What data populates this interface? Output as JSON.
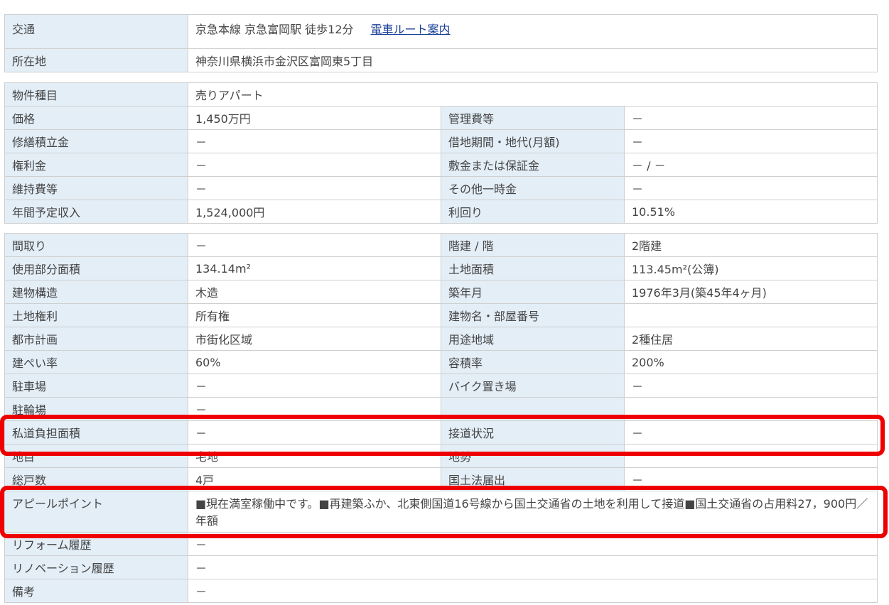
{
  "colors": {
    "header_bg": "#e3eef7",
    "border": "#cfcfcf",
    "link": "#1a3f99",
    "highlight": "#ee0000"
  },
  "access": {
    "transport_label": "交通",
    "transport_value": "京急本線 京急富岡駅 徒歩12分",
    "route_link": "電車ルート案内",
    "address_label": "所在地",
    "address_value": "神奈川県横浜市金沢区富岡東5丁目"
  },
  "price_table": {
    "type_label": "物件種目",
    "type_value": "売りアパート",
    "rows": [
      {
        "l1": "価格",
        "v1": "1,450万円",
        "l2": "管理費等",
        "v2": "－"
      },
      {
        "l1": "修繕積立金",
        "v1": "－",
        "l2": "借地期間・地代(月額)",
        "v2": "－"
      },
      {
        "l1": "権利金",
        "v1": "－",
        "l2": "敷金または保証金",
        "v2": "－ / －"
      },
      {
        "l1": "維持費等",
        "v1": "－",
        "l2": "その他一時金",
        "v2": "－"
      },
      {
        "l1": "年間予定収入",
        "v1": "1,524,000円",
        "l2": "利回り",
        "v2": "10.51%"
      }
    ]
  },
  "detail_table": {
    "rows": [
      {
        "l1": "間取り",
        "v1": "－",
        "l2": "階建 / 階",
        "v2": "2階建"
      },
      {
        "l1": "使用部分面積",
        "v1": "134.14m²",
        "l2": "土地面積",
        "v2": "113.45m²(公簿)"
      },
      {
        "l1": "建物構造",
        "v1": "木造",
        "l2": "築年月",
        "v2": "1976年3月(築45年4ヶ月)"
      },
      {
        "l1": "土地権利",
        "v1": "所有権",
        "l2": "建物名・部屋番号",
        "v2": ""
      },
      {
        "l1": "都市計画",
        "v1": "市街化区域",
        "l2": "用途地域",
        "v2": "2種住居"
      },
      {
        "l1": "建ぺい率",
        "v1": "60%",
        "l2": "容積率",
        "v2": "200%"
      },
      {
        "l1": "駐車場",
        "v1": "－",
        "l2": "バイク置き場",
        "v2": "－"
      },
      {
        "l1": "駐輪場",
        "v1": "－",
        "l2": "",
        "v2": ""
      },
      {
        "l1": "私道負担面積",
        "v1": "－",
        "l2": "接道状況",
        "v2": "－"
      },
      {
        "l1": "地目",
        "v1": "宅地",
        "l2": "地勢",
        "v2": ""
      },
      {
        "l1": "総戸数",
        "v1": "4戸",
        "l2": "国土法届出",
        "v2": "－"
      }
    ],
    "appeal_label": "アピールポイント",
    "appeal_value": "■現在満室稼働中です。■再建築ふか、北東側国道16号線から国土交通省の土地を利用して接道■国土交通省の占用料27，900円／年額",
    "reform_label": "リフォーム履歴",
    "reform_value": "－",
    "renovation_label": "リノベーション履歴",
    "renovation_value": "－",
    "notes_label": "備考",
    "notes_value": "－"
  }
}
